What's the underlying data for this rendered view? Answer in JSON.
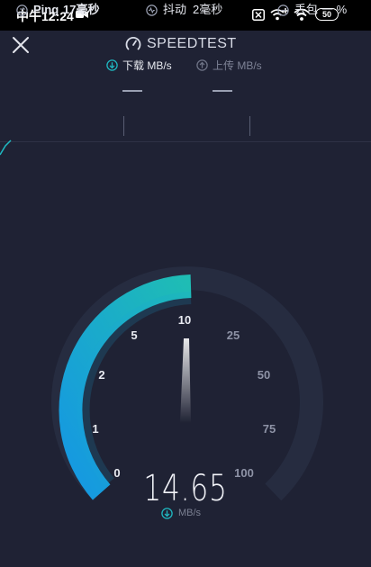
{
  "status_bar": {
    "time": "中午12:24",
    "battery": "50",
    "icons": [
      "video-camera-icon",
      "sim-cross-icon",
      "wifi-plus-icon",
      "wifi-icon",
      "battery-icon"
    ]
  },
  "header": {
    "title": "SPEEDTEST",
    "close_icon": "close-icon"
  },
  "tabs": {
    "download": {
      "label": "下载 MB/s",
      "value": "—",
      "active": true
    },
    "upload": {
      "label": "上传 MB/s",
      "value": "—",
      "active": false
    }
  },
  "stats": {
    "ping": {
      "label": "Ping",
      "value": "17毫秒"
    },
    "jitter": {
      "label": "抖动",
      "value": "2毫秒"
    },
    "loss": {
      "label": "丢包",
      "value": "一 %"
    }
  },
  "gauge": {
    "scale": [
      "0",
      "1",
      "2",
      "5",
      "10",
      "25",
      "50",
      "75",
      "100"
    ],
    "reading": "14.65",
    "unit": "MB/s",
    "progress_fraction": 0.52,
    "colors": {
      "fill_start": "#1aa7e6",
      "fill_end": "#1fb9b6",
      "track": "#262c40",
      "background": "#1f2234"
    }
  }
}
